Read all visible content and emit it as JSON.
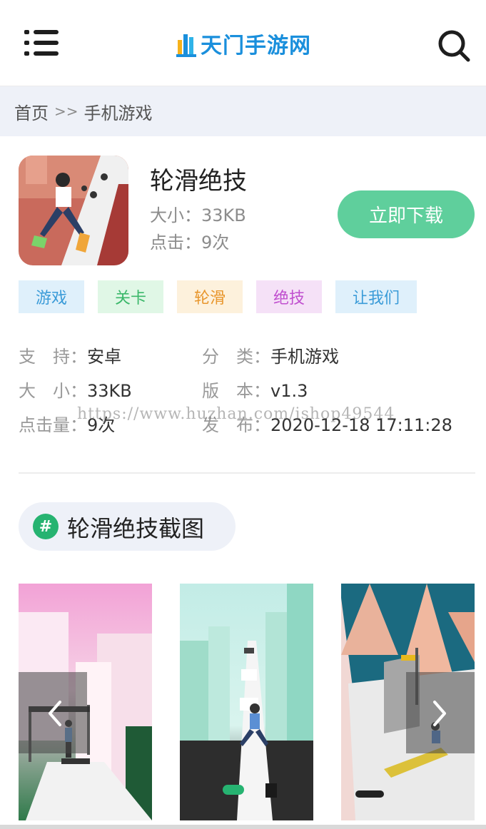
{
  "header": {
    "logo_text": "天门手游网",
    "brand_color": "#1a8fdc",
    "menu_icon": "hamburger-menu-icon",
    "search_icon": "search-icon"
  },
  "breadcrumb": {
    "home": "首页",
    "separator": ">>",
    "current": "手机游戏"
  },
  "app": {
    "title": "轮滑绝技",
    "size_line": "大小：33KB",
    "clicks_line": "点击：9次",
    "download_label": "立即下载",
    "download_color": "#5fcf9c"
  },
  "tags": [
    {
      "label": "游戏",
      "bg": "#dff0fb",
      "fg": "#3a9bd8"
    },
    {
      "label": "关卡",
      "bg": "#e0f7e6",
      "fg": "#3bb86a"
    },
    {
      "label": "轮滑",
      "bg": "#fdf1dc",
      "fg": "#e8962c"
    },
    {
      "label": "绝技",
      "bg": "#f5e1f7",
      "fg": "#c04fcf"
    },
    {
      "label": "让我们",
      "bg": "#dff0fb",
      "fg": "#3a9bd8"
    }
  ],
  "details": {
    "support_key": "支　持：",
    "support_val": "安卓",
    "category_key": "分　类：",
    "category_val": "手机游戏",
    "size_key": "大　小：",
    "size_val": "33KB",
    "version_key": "版　本：",
    "version_val": "v1.3",
    "clicks_key": "点击量：",
    "clicks_val": "9次",
    "release_key": "发　布：",
    "release_val": "2020-12-18 17:11:28"
  },
  "watermark": "https://www.huzhan.com/ishop49544",
  "screenshots": {
    "hash_symbol": "#",
    "title": "轮滑绝技截图",
    "accent": "#26b371",
    "prev_icon": "chevron-left-icon",
    "next_icon": "chevron-right-icon"
  }
}
